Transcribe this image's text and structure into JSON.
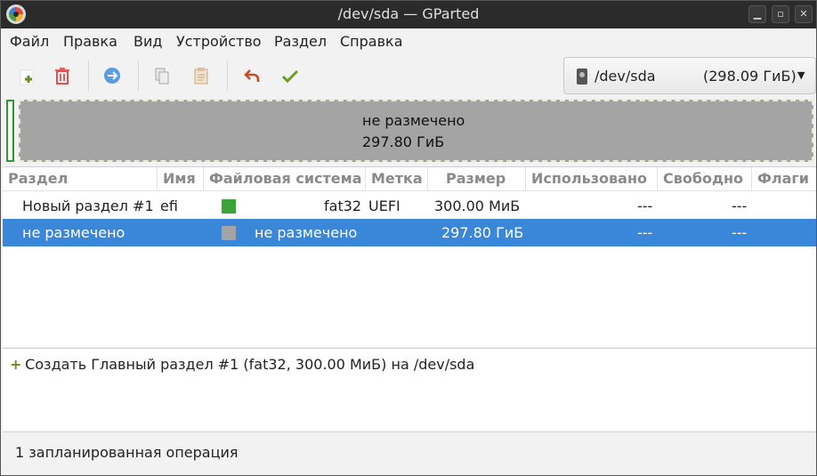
{
  "window": {
    "title": "/dev/sda — GParted",
    "controls": {
      "minimize": "▁",
      "maximize": "▫",
      "close": "✕"
    }
  },
  "menu": [
    "Файл",
    "Правка",
    "Вид",
    "Устройство",
    "Раздел",
    "Справка"
  ],
  "toolbar": {
    "buttons": [
      {
        "name": "new-partition",
        "icon": "plus-icon",
        "color": "#6b8e23"
      },
      {
        "name": "delete-partition",
        "icon": "trash-icon",
        "color": "#e05050"
      },
      {
        "name": "resize-move",
        "icon": "arrow-right-circle-icon",
        "color": "#4a90d9"
      },
      {
        "name": "copy",
        "icon": "copy-icon",
        "color": "#9a9a9a"
      },
      {
        "name": "paste",
        "icon": "paste-icon",
        "color": "#c8a880"
      },
      {
        "name": "undo",
        "icon": "undo-icon",
        "color": "#c0502a"
      },
      {
        "name": "apply",
        "icon": "checkmark-icon",
        "color": "#6b9e1e"
      }
    ],
    "device": {
      "name": "/dev/sda",
      "size": "(298.09 ГиБ)",
      "arrow": "▼"
    }
  },
  "disk_map": {
    "unallocated_label": "не размечено",
    "unallocated_size": "297.80 ГиБ"
  },
  "partition_table": {
    "columns": [
      "Раздел",
      "Имя",
      "Файловая система",
      "Метка",
      "Размер",
      "Использовано",
      "Свободно",
      "Флаги"
    ],
    "rows": [
      {
        "partition": "Новый раздел #1",
        "name": "efi",
        "fs": "fat32",
        "fs_color": "#3aa33a",
        "label": "UEFI",
        "size": "300.00 МиБ",
        "used": "---",
        "free": "---",
        "flags": "",
        "selected": false
      },
      {
        "partition": "не размечено",
        "name": "",
        "fs": "не размечено",
        "fs_color": "#a4a4a4",
        "label": "",
        "size": "297.80 ГиБ",
        "used": "---",
        "free": "---",
        "flags": "",
        "selected": true
      }
    ]
  },
  "operations": {
    "items": [
      "Создать Главный раздел #1 (fat32, 300.00 МиБ) на /dev/sda"
    ],
    "plus": "+"
  },
  "status": "1 запланированная операция"
}
